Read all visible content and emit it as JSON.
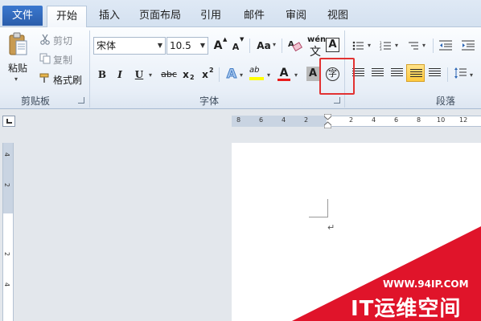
{
  "tabs": {
    "file": "文件",
    "home": "开始",
    "insert": "插入",
    "layout": "页面布局",
    "references": "引用",
    "mailings": "邮件",
    "review": "审阅",
    "view": "视图"
  },
  "clipboard": {
    "paste": "粘贴",
    "cut": "剪切",
    "copy": "复制",
    "format_painter": "格式刷",
    "group_label": "剪贴板"
  },
  "font": {
    "font_name": "宋体",
    "font_size": "10.5",
    "grow": "A",
    "shrink": "A",
    "change_case": "Aa",
    "wen": "wén",
    "char_border": "A",
    "bold": "B",
    "italic": "I",
    "underline": "U",
    "strike": "abc",
    "subscript": "x",
    "superscript": "x",
    "sub_mark": "2",
    "sup_mark": "2",
    "text_effects": "A",
    "highlight": "ab",
    "font_color": "A",
    "char_shading": "A",
    "enclose_char": "字",
    "group_label": "字体"
  },
  "paragraph": {
    "group_label": "段落"
  },
  "ruler": {
    "h_ticks": [
      "8",
      "6",
      "4",
      "2",
      "2",
      "4",
      "6",
      "8",
      "10",
      "12"
    ],
    "v_ticks": [
      "4",
      "2",
      "2",
      "4"
    ]
  },
  "document": {
    "paragraph_mark": "↵"
  },
  "watermark": {
    "url": "WWW.94IP.COM",
    "title": "IT运维空间"
  },
  "colors": {
    "highlight_yellow": "#ffff00",
    "font_red": "#e81c1c",
    "annotation_red": "#e23232",
    "watermark_red": "#e0142a"
  }
}
